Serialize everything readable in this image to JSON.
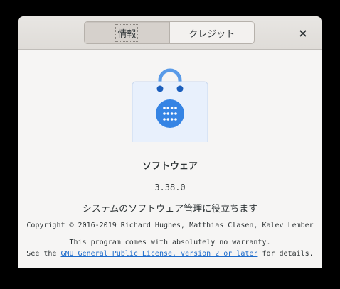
{
  "header": {
    "tabs": [
      {
        "label": "情報",
        "active": true
      },
      {
        "label": "クレジット",
        "active": false
      }
    ],
    "close_icon": "×"
  },
  "about": {
    "icon": "software-bag-icon",
    "app_name": "ソフトウェア",
    "version": "3.38.0",
    "comment": "システムのソフトウェア管理に役立ちます",
    "copyright": "Copyright © 2016-2019 Richard Hughes, Matthias Clasen, Kalev Lember",
    "warranty": "This program comes with absolutely no warranty.",
    "license_prefix": "See the ",
    "license_link": "GNU General Public License, version 2 or later",
    "license_suffix": " for details."
  },
  "colors": {
    "accent": "#3584e4",
    "link": "#1b6acb",
    "icon_bag": "#e8f0fc"
  }
}
